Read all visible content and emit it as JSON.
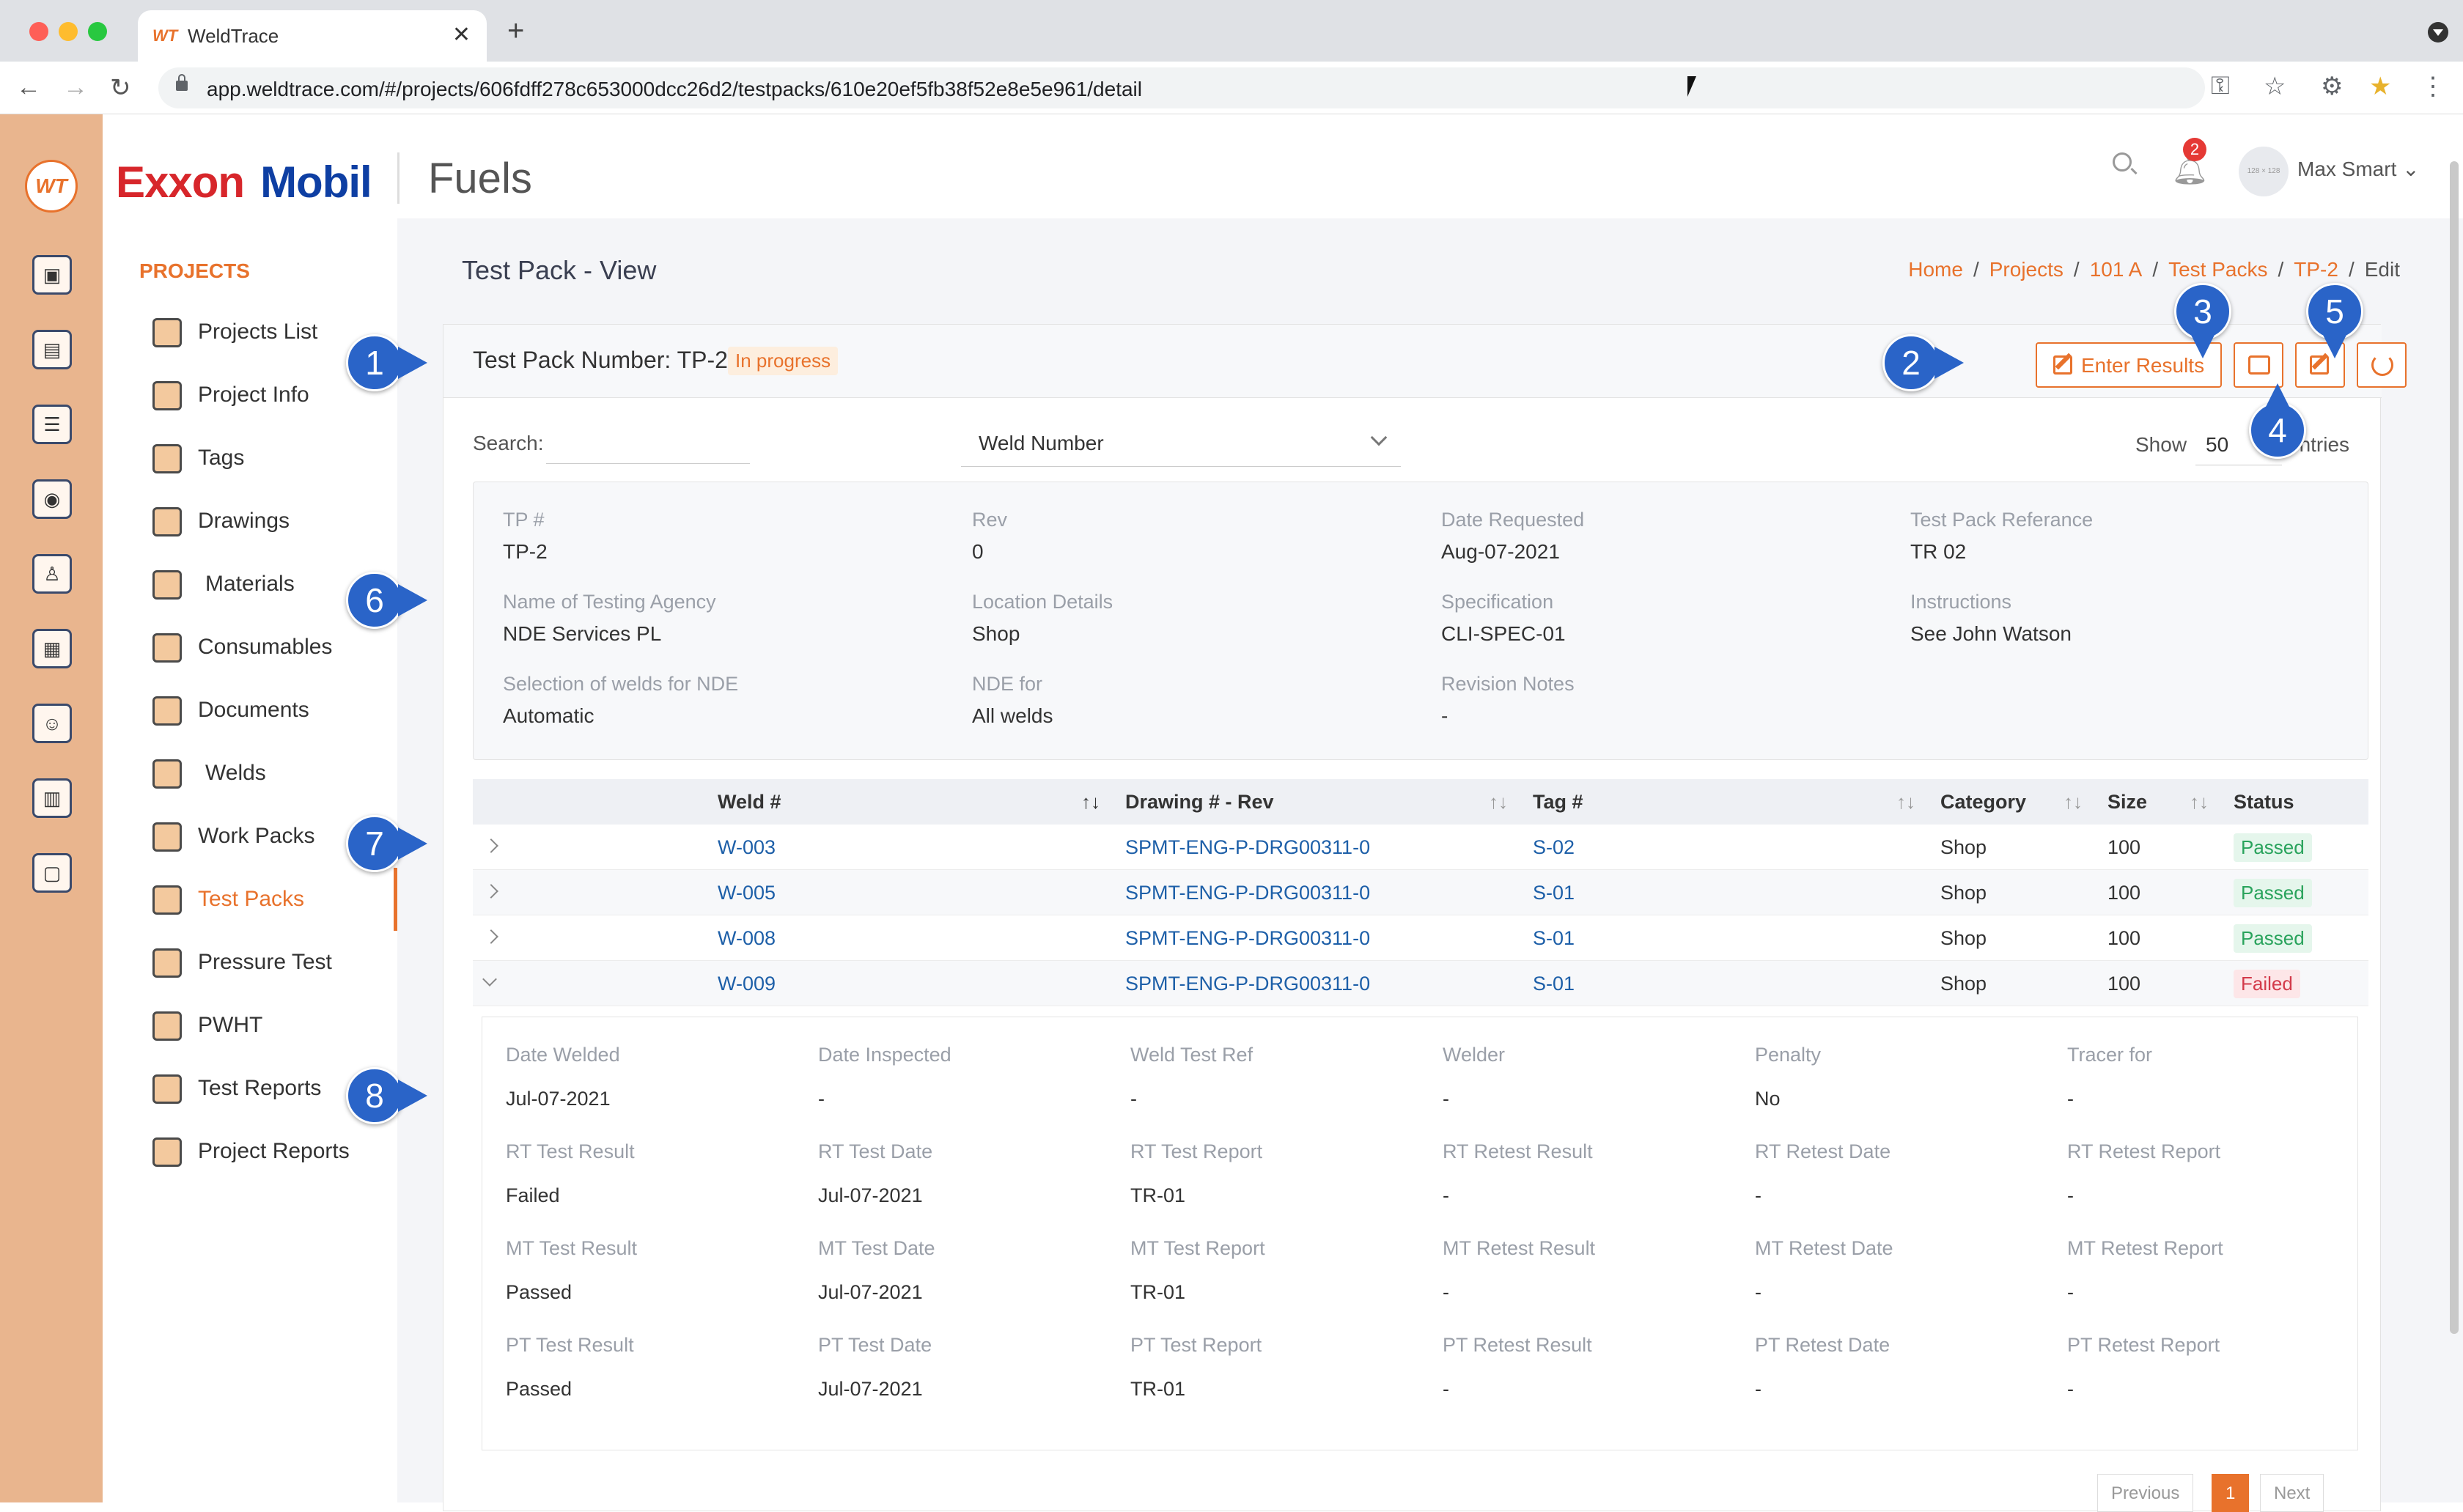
{
  "browser": {
    "tab_logo": "WT",
    "tab_title": "WeldTrace",
    "url": "app.weldtrace.com/#/projects/606fdff278c653000dcc26d2/testpacks/610e20ef5fb38f52e8e5e961/detail"
  },
  "brand": {
    "part1": "Exxon",
    "part2": "Mobil",
    "division": "Fuels"
  },
  "rail_logo": "WT",
  "header": {
    "notifications": "2",
    "avatar_text": "128 × 128",
    "user": "Max Smart ⌄"
  },
  "sidebar": {
    "heading": "PROJECTS",
    "items": [
      {
        "label": "Projects List"
      },
      {
        "label": "Project Info"
      },
      {
        "label": "Tags"
      },
      {
        "label": "Drawings"
      },
      {
        "label": "Materials"
      },
      {
        "label": "Consumables"
      },
      {
        "label": "Documents"
      },
      {
        "label": "Welds"
      },
      {
        "label": "Work Packs"
      },
      {
        "label": "Test Packs"
      },
      {
        "label": "Pressure Test"
      },
      {
        "label": "PWHT"
      },
      {
        "label": "Test Reports"
      },
      {
        "label": "Project Reports"
      }
    ]
  },
  "page": {
    "title": "Test Pack - View",
    "breadcrumb": [
      "Home",
      "Projects",
      "101 A",
      "Test Packs",
      "TP-2",
      "Edit"
    ]
  },
  "card": {
    "title": "Test Pack Number: TP-2",
    "status": "In progress",
    "enter_results": "Enter Results",
    "search_label": "Search:",
    "search_value": "",
    "filter_value": "Weld Number",
    "show_label": "Show",
    "show_value": "50",
    "entries_label": "entries"
  },
  "fields": [
    {
      "label": "TP #",
      "value": "TP-2"
    },
    {
      "label": "Rev",
      "value": "0"
    },
    {
      "label": "Date Requested",
      "value": "Aug-07-2021"
    },
    {
      "label": "Test Pack Referance",
      "value": "TR 02"
    },
    {
      "label": "Name of Testing Agency",
      "value": "NDE Services PL"
    },
    {
      "label": "Location Details",
      "value": "Shop"
    },
    {
      "label": "Specification",
      "value": "CLI-SPEC-01"
    },
    {
      "label": "Instructions",
      "value": "See John Watson"
    },
    {
      "label": "Selection of welds for NDE",
      "value": "Automatic"
    },
    {
      "label": "NDE for",
      "value": "All welds"
    },
    {
      "label": "Revision Notes",
      "value": "-"
    }
  ],
  "table": {
    "columns": [
      "Weld #",
      "Drawing # - Rev",
      "Tag #",
      "Category",
      "Size",
      "Status"
    ],
    "rows": [
      {
        "weld": "W-003",
        "drawing": "SPMT-ENG-P-DRG00311-0",
        "tag": "S-02",
        "category": "Shop",
        "size": "100",
        "status": "Passed"
      },
      {
        "weld": "W-005",
        "drawing": "SPMT-ENG-P-DRG00311-0",
        "tag": "S-01",
        "category": "Shop",
        "size": "100",
        "status": "Passed"
      },
      {
        "weld": "W-008",
        "drawing": "SPMT-ENG-P-DRG00311-0",
        "tag": "S-01",
        "category": "Shop",
        "size": "100",
        "status": "Passed"
      },
      {
        "weld": "W-009",
        "drawing": "SPMT-ENG-P-DRG00311-0",
        "tag": "S-01",
        "category": "Shop",
        "size": "100",
        "status": "Failed"
      }
    ]
  },
  "detail": {
    "rows": [
      [
        {
          "label": "Date Welded",
          "value": "Jul-07-2021"
        },
        {
          "label": "Date Inspected",
          "value": "-"
        },
        {
          "label": "Weld Test Ref",
          "value": "-"
        },
        {
          "label": "Welder",
          "value": "-"
        },
        {
          "label": "Penalty",
          "value": "No"
        },
        {
          "label": "Tracer for",
          "value": "-"
        }
      ],
      [
        {
          "label": "RT Test Result",
          "value": "Failed"
        },
        {
          "label": "RT Test Date",
          "value": "Jul-07-2021"
        },
        {
          "label": "RT Test Report",
          "value": "TR-01"
        },
        {
          "label": "RT Retest Result",
          "value": "-"
        },
        {
          "label": "RT Retest Date",
          "value": "-"
        },
        {
          "label": "RT Retest Report",
          "value": "-"
        }
      ],
      [
        {
          "label": "MT Test Result",
          "value": "Passed"
        },
        {
          "label": "MT Test Date",
          "value": "Jul-07-2021"
        },
        {
          "label": "MT Test Report",
          "value": "TR-01"
        },
        {
          "label": "MT Retest Result",
          "value": "-"
        },
        {
          "label": "MT Retest Date",
          "value": "-"
        },
        {
          "label": "MT Retest Report",
          "value": "-"
        }
      ],
      [
        {
          "label": "PT Test Result",
          "value": "Passed"
        },
        {
          "label": "PT Test Date",
          "value": "Jul-07-2021"
        },
        {
          "label": "PT Test Report",
          "value": "TR-01"
        },
        {
          "label": "PT Retest Result",
          "value": "-"
        },
        {
          "label": "PT Retest Date",
          "value": "-"
        },
        {
          "label": "PT Retest Report",
          "value": "-"
        }
      ]
    ]
  },
  "pager": {
    "prev": "Previous",
    "page": "1",
    "next": "Next"
  },
  "callouts": [
    "1",
    "2",
    "3",
    "4",
    "5",
    "6",
    "7",
    "8"
  ],
  "colors": {
    "accent": "#e8722c",
    "link": "#1d5fa8",
    "callout": "#2a64c8",
    "passed": "#29a35c",
    "failed": "#d33a4a"
  }
}
